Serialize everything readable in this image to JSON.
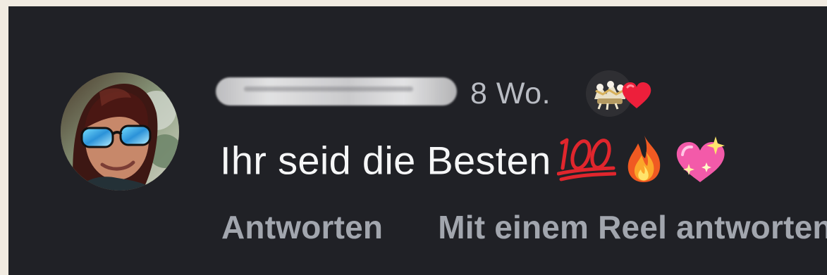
{
  "comment": {
    "username_redacted": true,
    "timestamp": "8 Wo.",
    "text": "Ihr seid die Besten",
    "text_emojis": [
      "hundred-points",
      "fire",
      "sparkling-heart"
    ],
    "liked_by_creator": true
  },
  "actions": {
    "reply_label": "Antworten",
    "reel_reply_label": "Mit einem Reel antworten"
  },
  "colors": {
    "background": "#202126",
    "outer_frame": "#f1ebe1",
    "primary_text": "#f5f6f7",
    "secondary_text": "#a2a6ae",
    "heart": "#ed1f3b"
  }
}
